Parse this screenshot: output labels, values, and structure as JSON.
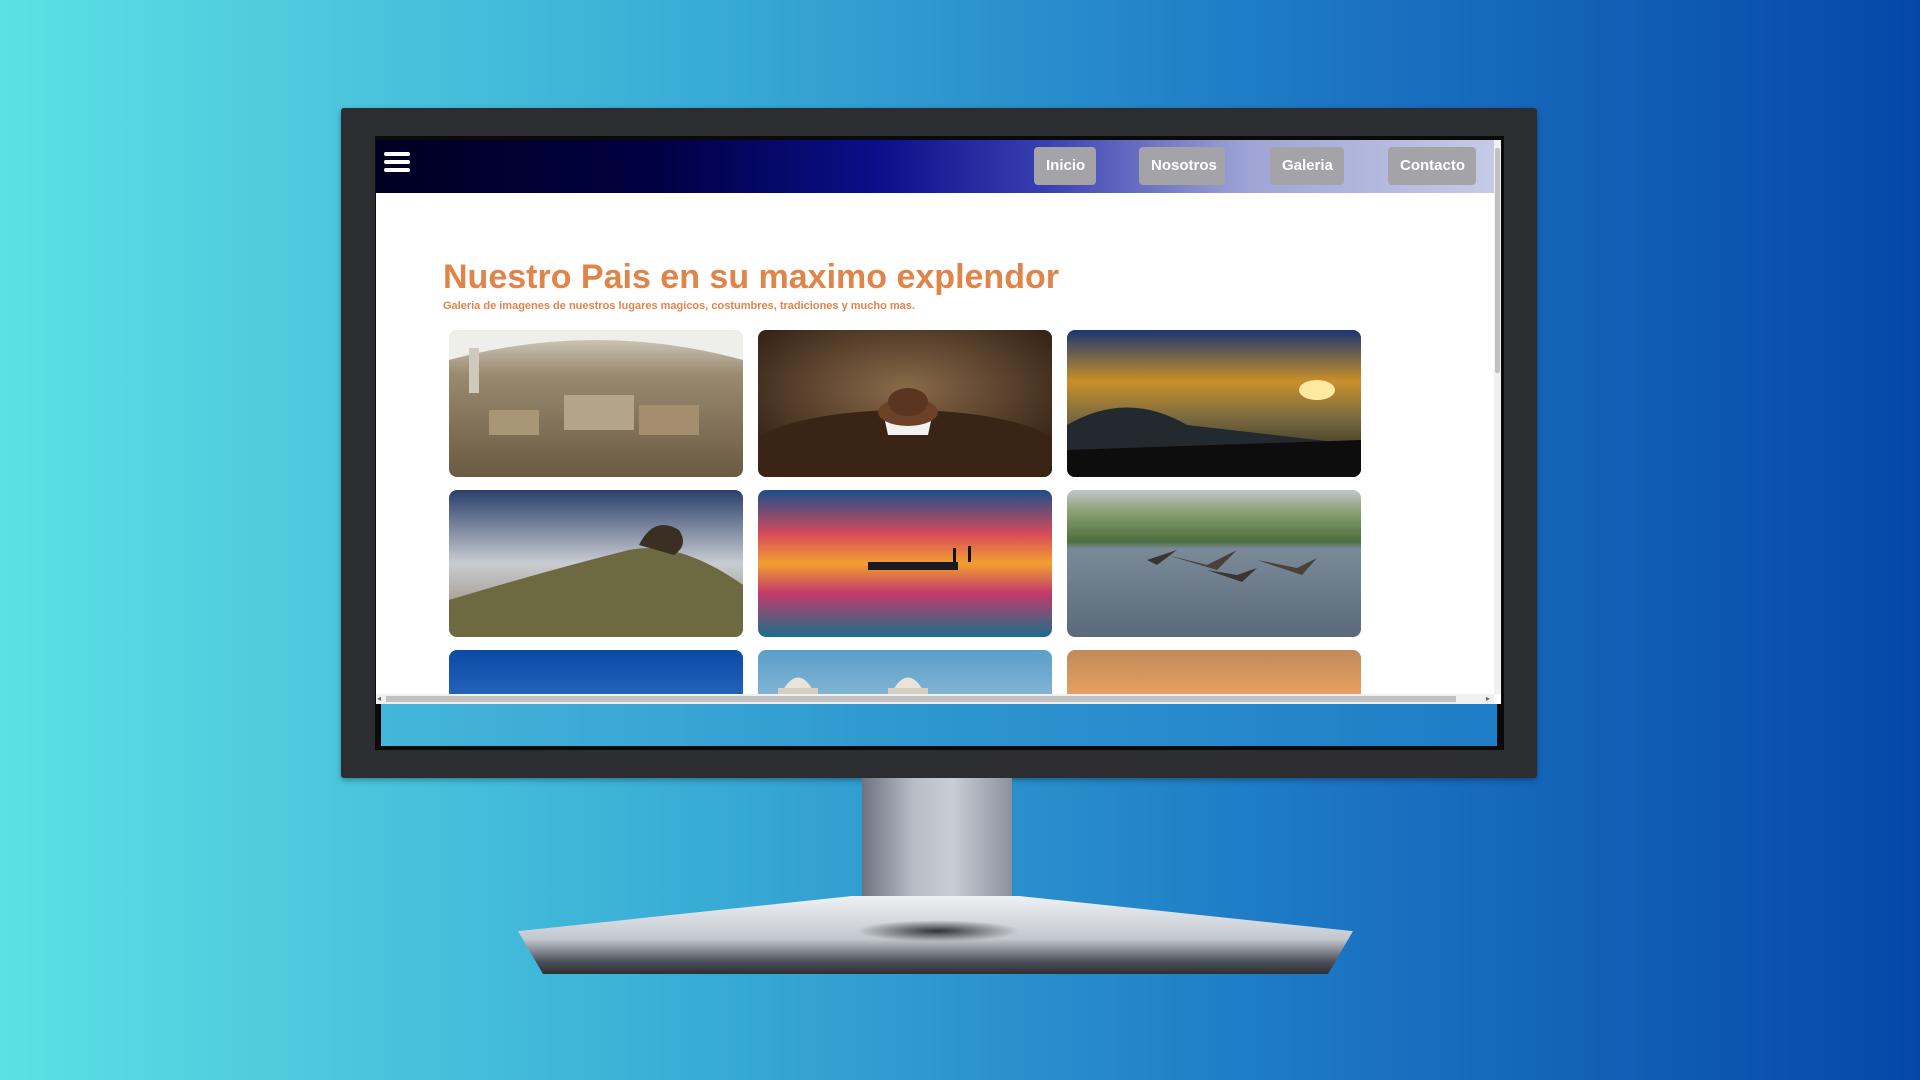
{
  "nav": {
    "items": [
      {
        "label": "Inicio"
      },
      {
        "label": "Nosotros"
      },
      {
        "label": "Galeria"
      },
      {
        "label": "Contacto"
      }
    ]
  },
  "hero": {
    "title": "Nuestro Pais en su maximo explendor",
    "subtitle": "Galeria de imagenes de nuestros lugares magicos, costumbres, tradiciones y mucho mas."
  },
  "colors": {
    "title": "#e0844a",
    "nav_button": "#a3a3a8"
  }
}
